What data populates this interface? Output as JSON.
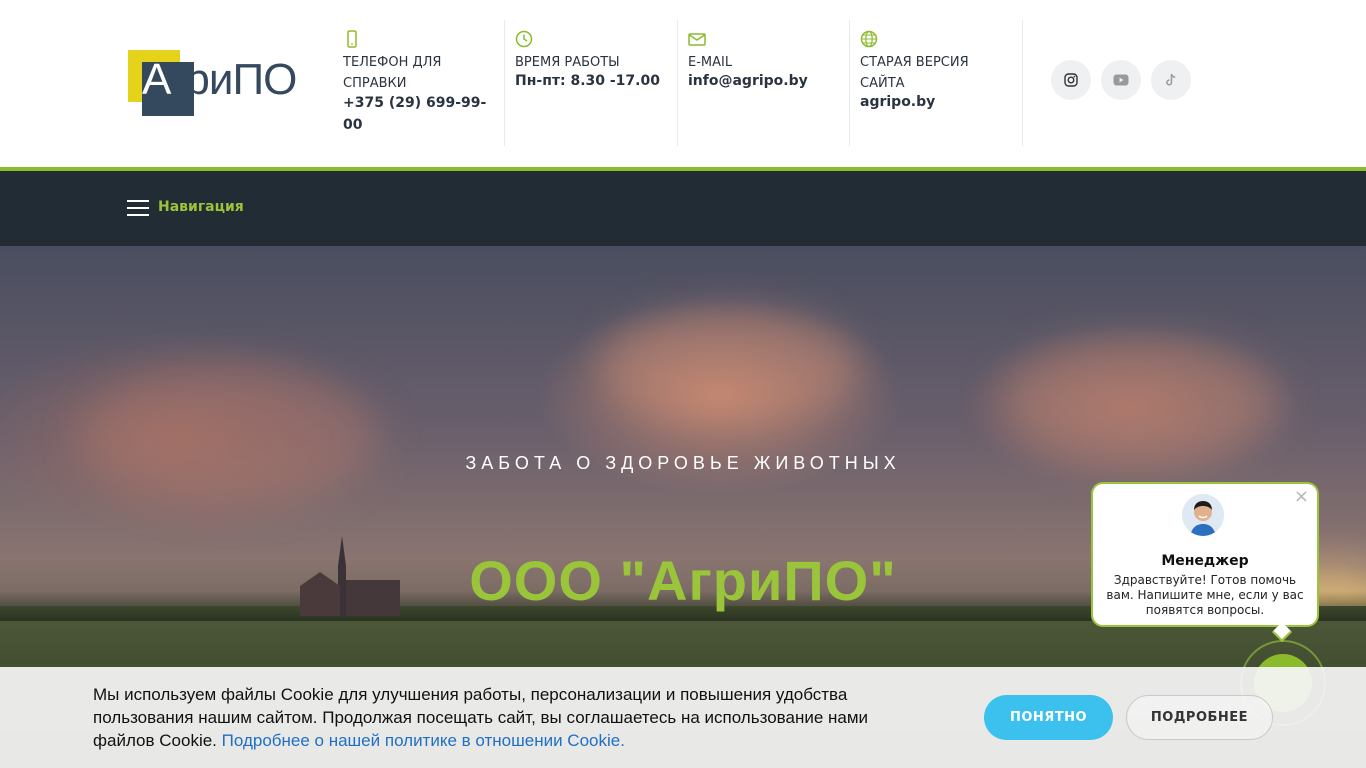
{
  "header": {
    "logo_text": "АгриПО",
    "phone": {
      "label": "Телефон для справки",
      "value": "+375 (29) 699-99-00"
    },
    "hours": {
      "label": "Время работы",
      "value": "Пн-пт: 8.30 -17.00"
    },
    "email": {
      "label": "E-mail",
      "value": "info@agripo.by"
    },
    "old_site": {
      "label": "Старая версия сайта",
      "value": "agripo.by"
    },
    "social": [
      "instagram-icon",
      "youtube-icon",
      "tiktok-icon"
    ]
  },
  "nav": {
    "label": "Навигация"
  },
  "hero": {
    "subtitle": "ЗАБОТА О ЗДОРОВЬЕ ЖИВОТНЫХ",
    "title": "ООО \"АгриПО\""
  },
  "chat": {
    "name": "Менеджер",
    "text": "Здравствуйте! Готов помочь вам. Напишите мне, если у вас появятся вопросы.",
    "close": "×"
  },
  "cookie": {
    "text": "Мы используем файлы Cookie для улучшения работы, персонализации и повышения удобства пользования нашим сайтом. Продолжая посещать сайт, вы соглашаетесь на использование нами файлов Cookie.",
    "link": "Подробнее о нашей политике в отношении Cookie.",
    "accept": "ПОНЯТНО",
    "more": "ПОДРОБНЕЕ"
  },
  "colors": {
    "accent": "#8bbb2b",
    "dark": "#222c35",
    "button": "#3cc0ee"
  }
}
